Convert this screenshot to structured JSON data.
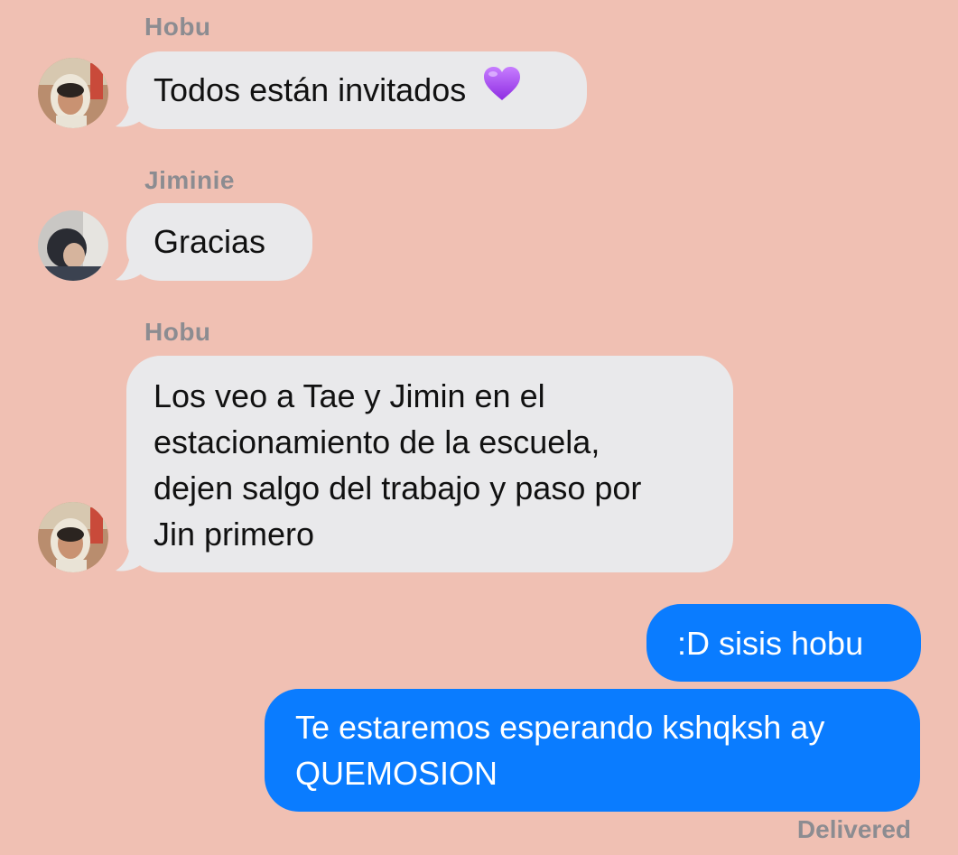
{
  "messages": [
    {
      "sender": "Hobu",
      "text": "Todos están invitados",
      "emoji": "purple-heart",
      "direction": "incoming"
    },
    {
      "sender": "Jiminie",
      "text": "Gracias",
      "direction": "incoming"
    },
    {
      "sender": "Hobu",
      "lines": [
        "Los veo a Tae y Jimin en el",
        "estacionamiento de la escuela,",
        "dejen salgo del trabajo y paso por",
        "Jin primero"
      ],
      "direction": "incoming"
    },
    {
      "text": ":D sisis hobu",
      "direction": "outgoing"
    },
    {
      "lines": [
        "Te estaremos esperando kshqksh ay",
        "QUEMOSION"
      ],
      "direction": "outgoing"
    }
  ],
  "status": "Delivered",
  "colors": {
    "background": "#F0C0B3",
    "incoming_bubble": "#E9E9EB",
    "outgoing_bubble": "#0A7CFF",
    "sender_label": "#8C8C91",
    "heart": "#A855F7"
  }
}
